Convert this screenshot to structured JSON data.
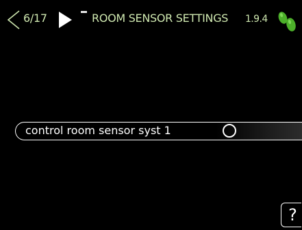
{
  "header": {
    "prev_icon": "chevron-left-outline-icon",
    "next_icon": "triangle-right-icon",
    "page_counter": "6/17",
    "title": "ROOM SENSOR SETTINGS",
    "menu_number": "1.9.4",
    "logo_icon": "green-leaves-logo",
    "text_color": "#cfe8b0",
    "accent_color": "#4caf2a"
  },
  "setting": {
    "label": "control room sensor syst 1",
    "checked": false
  },
  "help": {
    "label": "?"
  }
}
